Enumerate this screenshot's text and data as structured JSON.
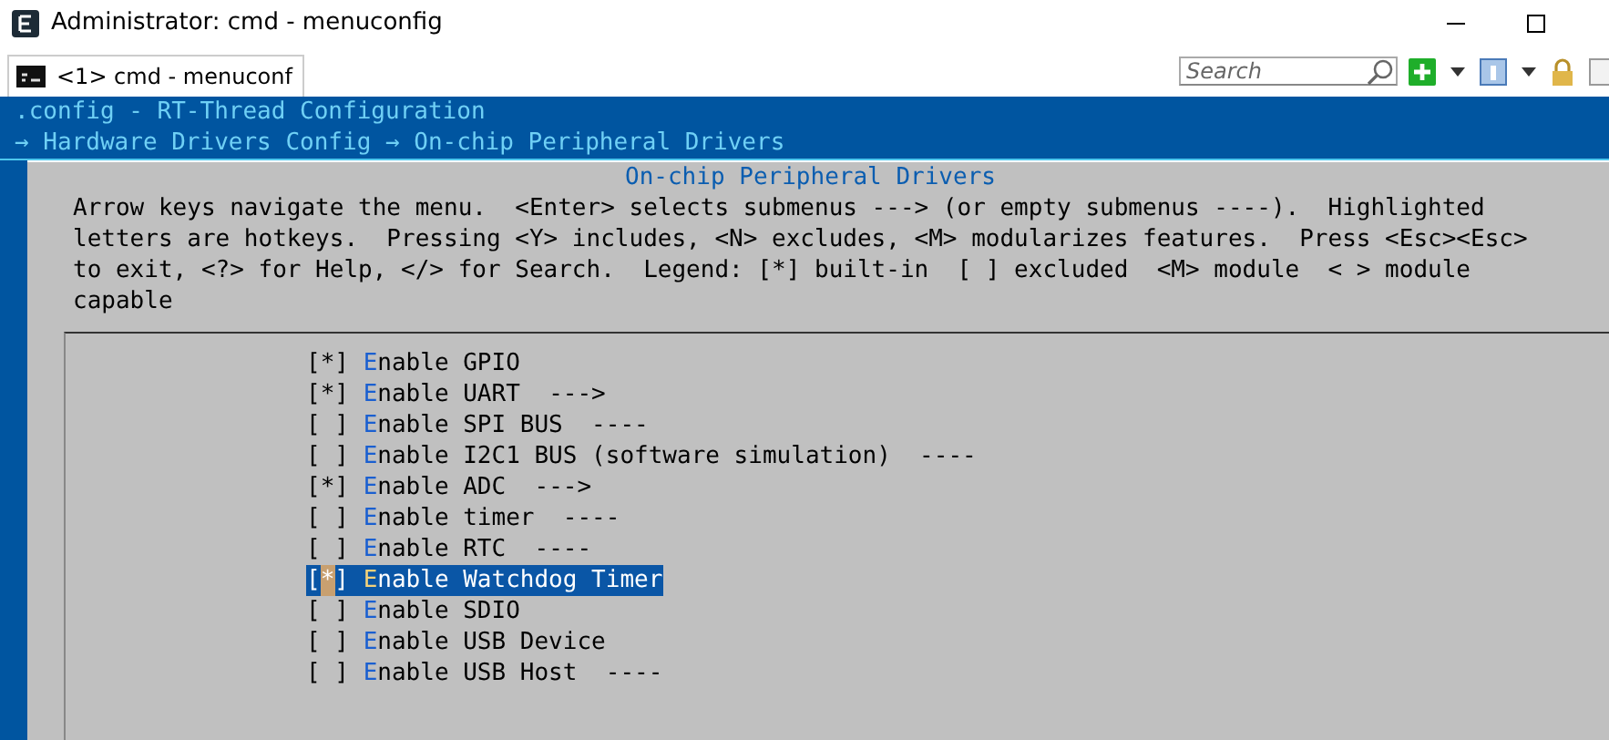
{
  "window": {
    "title": "Administrator: cmd - menuconfig"
  },
  "tabs": [
    {
      "label": "<1> cmd - menuconf",
      "selected": true
    }
  ],
  "search": {
    "placeholder": "Search"
  },
  "terminal": {
    "header": ".config - RT-Thread Configuration",
    "breadcrumb": "→ Hardware Drivers Config → On-chip Peripheral Drivers",
    "dialog_title": "On-chip Peripheral Drivers",
    "help": "Arrow keys navigate the menu.  <Enter> selects submenus ---> (or empty submenus ----).  Highlighted letters are hotkeys.  Pressing <Y> includes, <N> excludes, <M> modularizes features.  Press <Esc><Esc> to exit, <?> for Help, </> for Search.  Legend: [*] built-in  [ ] excluded  <M> module  < > module capable",
    "items": [
      {
        "box": "[*]",
        "hotkey": "E",
        "label": "nable GPIO",
        "selected": false
      },
      {
        "box": "[*]",
        "hotkey": "E",
        "label": "nable UART",
        "suffix": "--->",
        "selected": false
      },
      {
        "box": "[ ]",
        "hotkey": "E",
        "label": "nable SPI BUS",
        "suffix": "----",
        "selected": false
      },
      {
        "box": "[ ]",
        "hotkey": "E",
        "label": "nable I2C1 BUS (software simulation)",
        "suffix": "----",
        "selected": false
      },
      {
        "box": "[*]",
        "hotkey": "E",
        "label": "nable ADC",
        "suffix": "--->",
        "selected": false
      },
      {
        "box": "[ ]",
        "hotkey": "E",
        "label": "nable timer",
        "suffix": "----",
        "selected": false
      },
      {
        "box": "[ ]",
        "hotkey": "E",
        "label": "nable RTC",
        "suffix": "----",
        "selected": false
      },
      {
        "box": "[*]",
        "hotkey": "E",
        "label": "nable Watchdog Timer",
        "selected": true
      },
      {
        "box": "[ ]",
        "hotkey": "E",
        "label": "nable SDIO",
        "selected": false
      },
      {
        "box": "[ ]",
        "hotkey": "E",
        "label": "nable USB Device",
        "selected": false
      },
      {
        "box": "[ ]",
        "hotkey": "E",
        "label": "nable USB Host",
        "suffix": "----",
        "selected": false
      }
    ]
  }
}
